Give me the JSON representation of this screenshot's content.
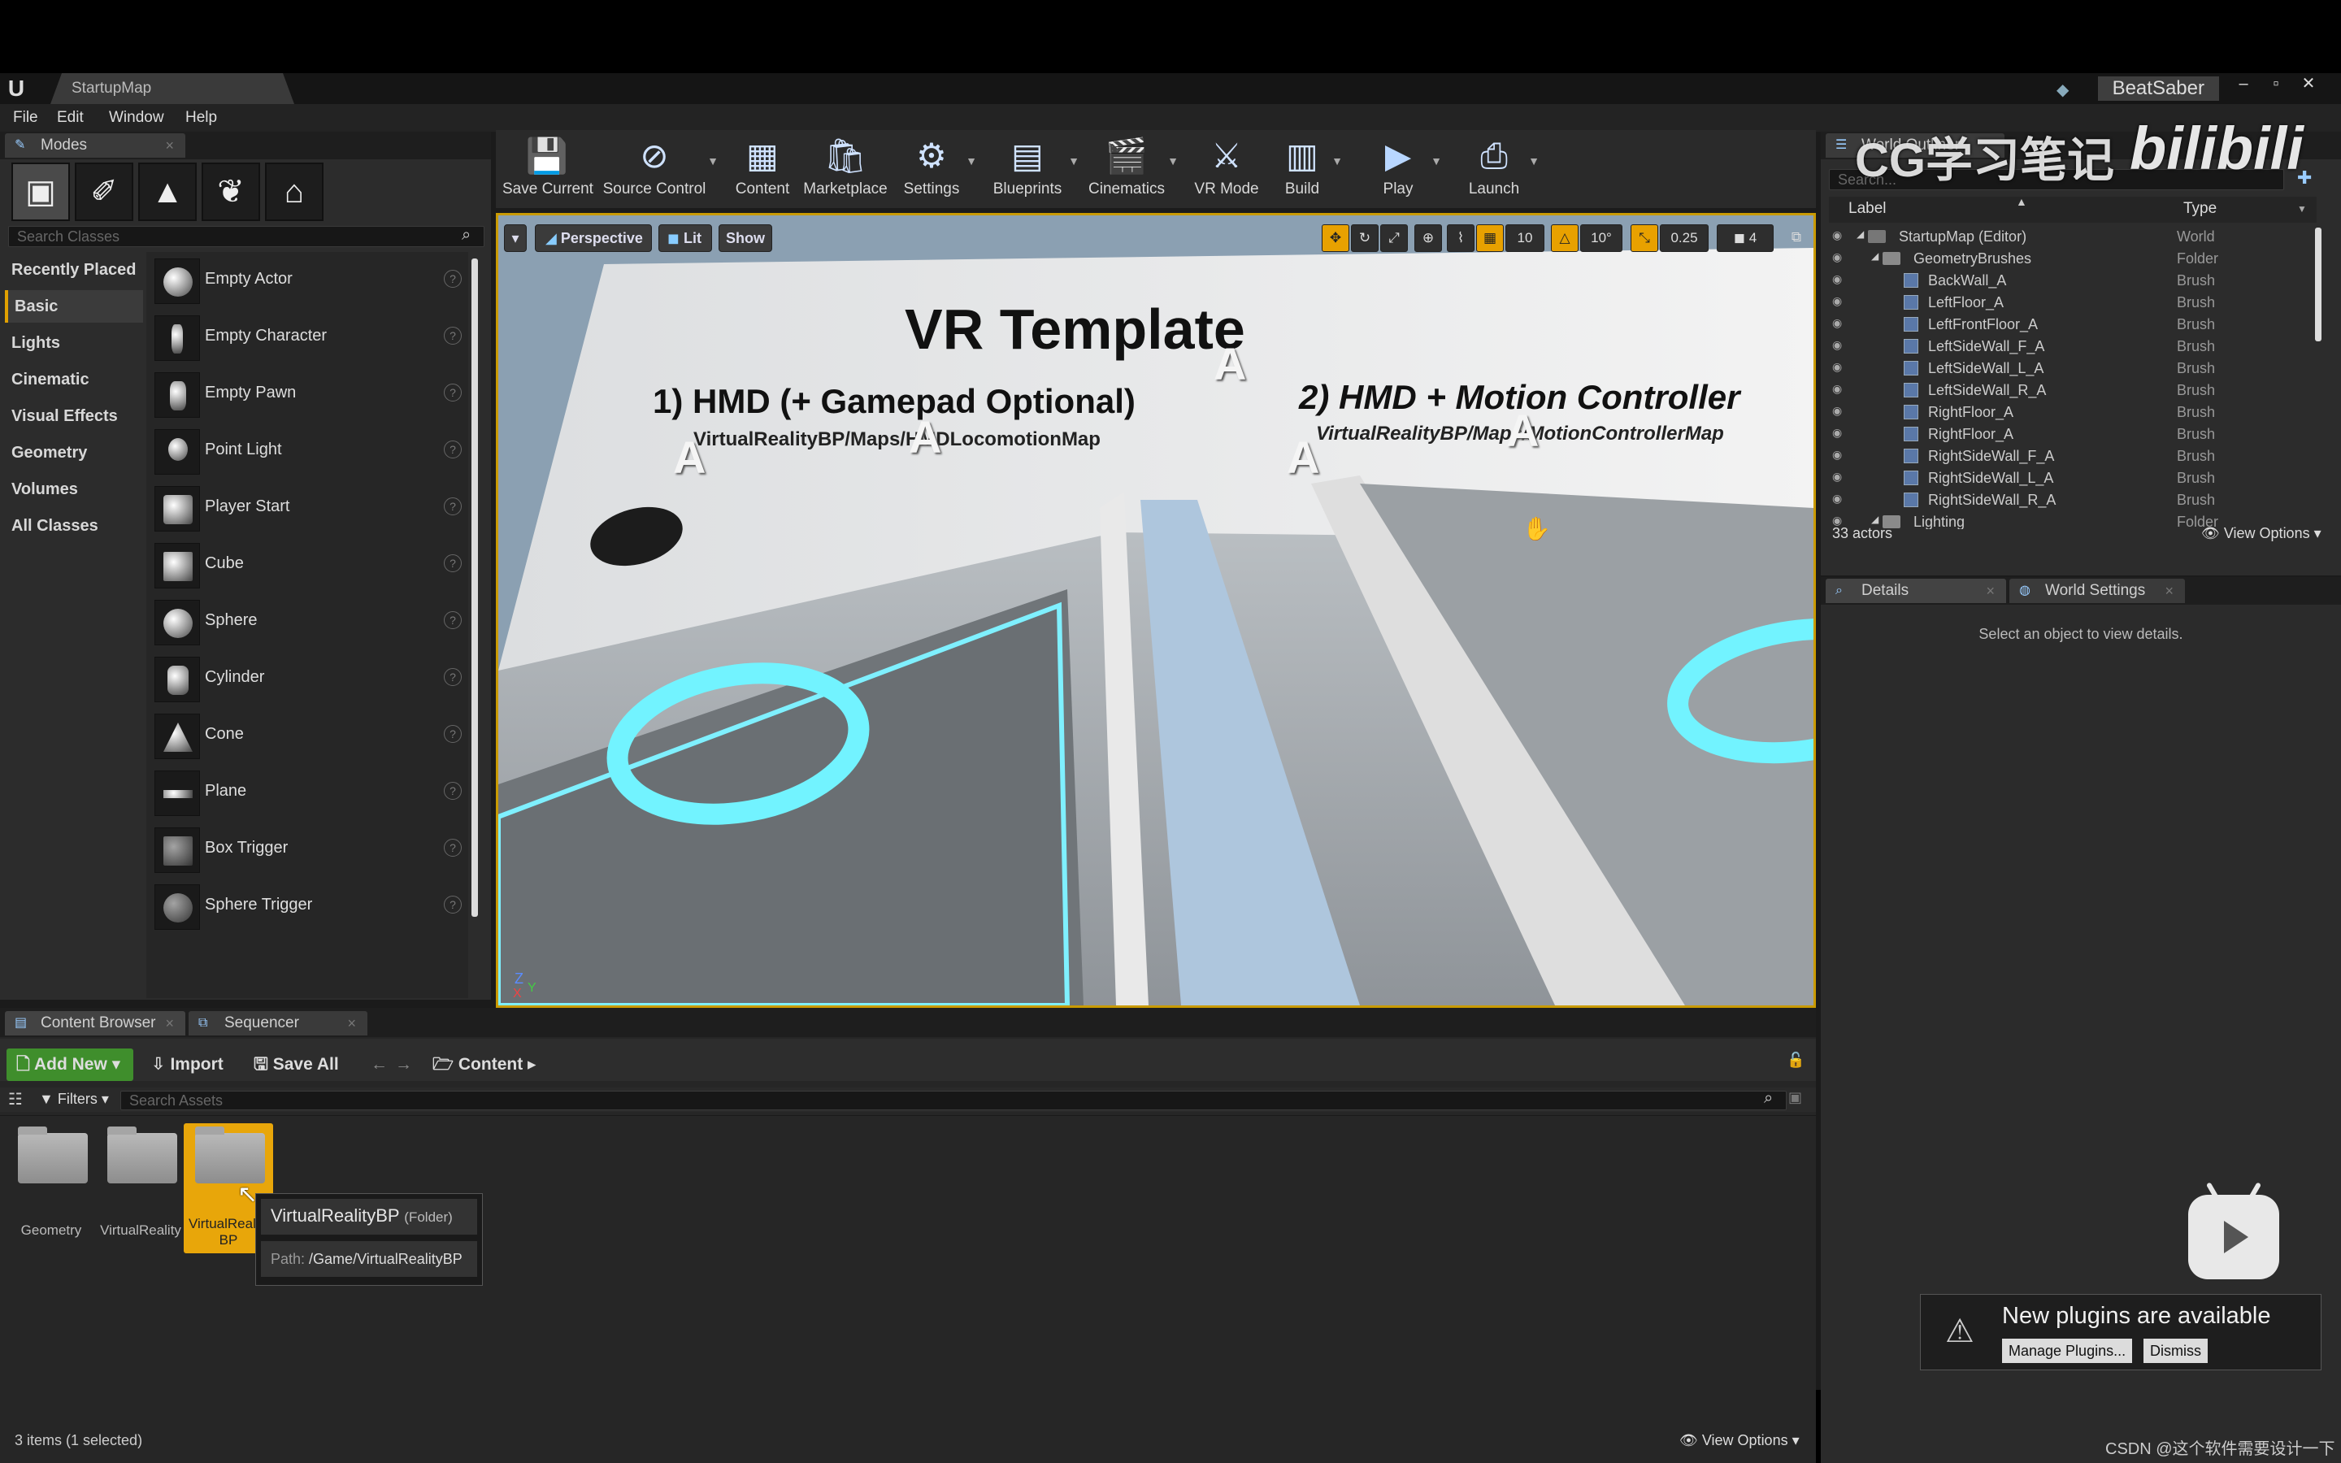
{
  "window": {
    "map_tab": "StartupMap",
    "project": "BeatSaber"
  },
  "menu": [
    "File",
    "Edit",
    "Window",
    "Help"
  ],
  "modes": {
    "tab": "Modes",
    "search_placeholder": "Search Classes",
    "categories": [
      "Recently Placed",
      "Basic",
      "Lights",
      "Cinematic",
      "Visual Effects",
      "Geometry",
      "Volumes",
      "All Classes"
    ],
    "selected_category": "Basic",
    "items": [
      "Empty Actor",
      "Empty Character",
      "Empty Pawn",
      "Point Light",
      "Player Start",
      "Cube",
      "Sphere",
      "Cylinder",
      "Cone",
      "Plane",
      "Box Trigger",
      "Sphere Trigger"
    ]
  },
  "toolbar": [
    "Save Current",
    "Source Control",
    "Content",
    "Marketplace",
    "Settings",
    "Blueprints",
    "Cinematics",
    "VR Mode",
    "Build",
    "Play",
    "Launch"
  ],
  "viewport": {
    "perspective": "Perspective",
    "lit": "Lit",
    "show": "Show",
    "grid_snap": "10",
    "rot_snap": "10°",
    "scale_snap": "0.25",
    "cam_speed": "4",
    "scene_title": "VR Template",
    "heading1": "1) HMD (+ Gamepad Optional)",
    "sub1": "VirtualRealityBP/Maps/HMDLocomotionMap",
    "heading2": "2) HMD + Motion Controller",
    "sub2": "VirtualRealityBP/Maps/MotionControllerMap"
  },
  "outliner": {
    "tab": "World Outliner",
    "search_placeholder": "Search...",
    "col_label": "Label",
    "col_type": "Type",
    "rows": [
      {
        "name": "StartupMap (Editor)",
        "type": "World"
      },
      {
        "name": "GeometryBrushes",
        "type": "Folder"
      },
      {
        "name": "BackWall_A",
        "type": "Brush"
      },
      {
        "name": "LeftFloor_A",
        "type": "Brush"
      },
      {
        "name": "LeftFrontFloor_A",
        "type": "Brush"
      },
      {
        "name": "LeftSideWall_F_A",
        "type": "Brush"
      },
      {
        "name": "LeftSideWall_L_A",
        "type": "Brush"
      },
      {
        "name": "LeftSideWall_R_A",
        "type": "Brush"
      },
      {
        "name": "RightFloor_A",
        "type": "Brush"
      },
      {
        "name": "RightFloor_A",
        "type": "Brush"
      },
      {
        "name": "RightSideWall_F_A",
        "type": "Brush"
      },
      {
        "name": "RightSideWall_L_A",
        "type": "Brush"
      },
      {
        "name": "RightSideWall_R_A",
        "type": "Brush"
      },
      {
        "name": "Lighting",
        "type": "Folder"
      }
    ],
    "count": "33 actors",
    "view_options": "View Options"
  },
  "details": {
    "tab1": "Details",
    "tab2": "World Settings",
    "empty_text": "Select an object to view details."
  },
  "content_browser": {
    "tab1": "Content Browser",
    "tab2": "Sequencer",
    "add_new": "Add New",
    "import": "Import",
    "save_all": "Save All",
    "path": "Content",
    "filters": "Filters",
    "search_placeholder": "Search Assets",
    "folders": [
      "Geometry",
      "VirtualReality",
      "VirtualReality BP"
    ],
    "tooltip_title": "VirtualRealityBP",
    "tooltip_kind": "(Folder)",
    "tooltip_path_label": "Path:",
    "tooltip_path": "/Game/VirtualRealityBP",
    "status": "3 items (1 selected)",
    "view_options": "View Options"
  },
  "notification": {
    "title": "New plugins are available",
    "manage": "Manage Plugins...",
    "dismiss": "Dismiss"
  },
  "watermark": {
    "cn": "CG学习笔记",
    "bili": "bilibili",
    "footer": "CSDN @这个软件需要设计一下"
  }
}
